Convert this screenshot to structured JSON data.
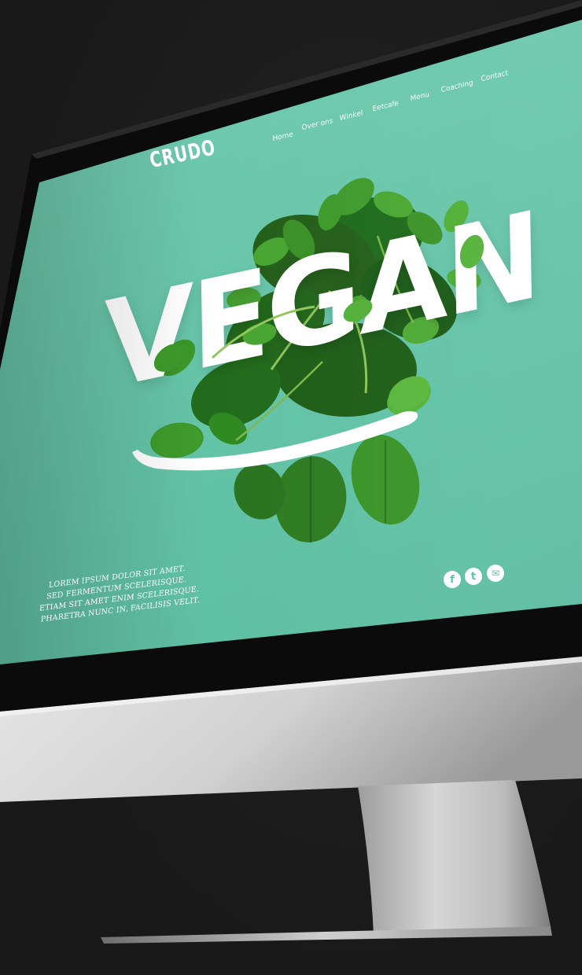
{
  "site": {
    "logo": "CRUDO",
    "nav": [
      "Home",
      "Over ons",
      "Winkel",
      "Eetcafe",
      "Menu",
      "Coaching",
      "Contact"
    ],
    "hero_word": "VEGAN",
    "copy_lines": [
      "Lorem ipsum dolor sit amet.",
      "Sed fermentum scelerisque.",
      "Etiam sit amet enim scelerisque.",
      "Pharetra nunc in, facilisis velit."
    ],
    "social": {
      "facebook": "f",
      "twitter": "t",
      "email": "✉"
    },
    "icons": [
      "facebook-icon",
      "twitter-icon",
      "email-icon"
    ]
  },
  "colors": {
    "screen_bg": "#63c3a6",
    "text": "#ffffff",
    "leaf_dark": "#1f6b1c",
    "leaf_mid": "#2f8a22",
    "leaf_light": "#55b33a",
    "bezel": "#0d0d0d",
    "chin": "#d9d9d9",
    "stand": "#b8b8b8"
  }
}
